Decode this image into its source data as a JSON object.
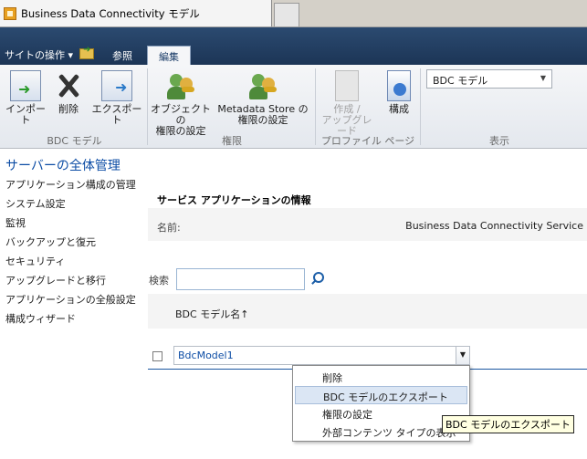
{
  "browser": {
    "tab_title": "Business Data Connectivity モデル"
  },
  "ribbon": {
    "site_actions": "サイトの操作 ▾",
    "tabs": [
      {
        "label": "参照"
      },
      {
        "label": "編集"
      }
    ],
    "buttons": {
      "import": "インポート",
      "delete": "削除",
      "export": "エクスポート",
      "object_perm_1": "オブジェクトの",
      "object_perm_2": "権限の設定",
      "store_perm_1": "Metadata Store の",
      "store_perm_2": "権限の設定",
      "create_upgrade_1": "作成 /",
      "create_upgrade_2": "アップグレード",
      "configure": "構成"
    },
    "groups": {
      "bdc_model": "BDC モデル",
      "permissions": "権限",
      "profile_page": "プロファイル ページ",
      "view": "表示"
    },
    "view_select": "BDC モデル",
    "icons": [
      "import-icon",
      "delete-icon",
      "export-icon",
      "object-permissions-icon",
      "metadata-store-permissions-icon",
      "create-upgrade-icon",
      "configure-icon"
    ]
  },
  "left_nav": {
    "header": "サーバーの全体管理",
    "items": [
      "アプリケーション構成の管理",
      "システム設定",
      "監視",
      "バックアップと復元",
      "セキュリティ",
      "アップグレードと移行",
      "アプリケーションの全般設定",
      "構成ウィザード"
    ]
  },
  "main": {
    "section_title": "サービス アプリケーションの情報",
    "name_label": "名前:",
    "name_value": "Business Data Connectivity Service",
    "search_label": "検索",
    "search_value": "",
    "column_header": "BDC モデル名↑",
    "rows": [
      {
        "name": "BdcModel1"
      }
    ]
  },
  "context_menu": {
    "items": [
      "削除",
      "BDC モデルのエクスポート",
      "権限の設定",
      "外部コンテンツ タイプの表示"
    ],
    "hover_index": 1
  },
  "tooltip": "BDC モデルのエクスポート",
  "colors": {
    "ribbon_dark": "#1c3556",
    "link_blue": "#0d4da5",
    "menu_hover": "#dbe6f4"
  }
}
